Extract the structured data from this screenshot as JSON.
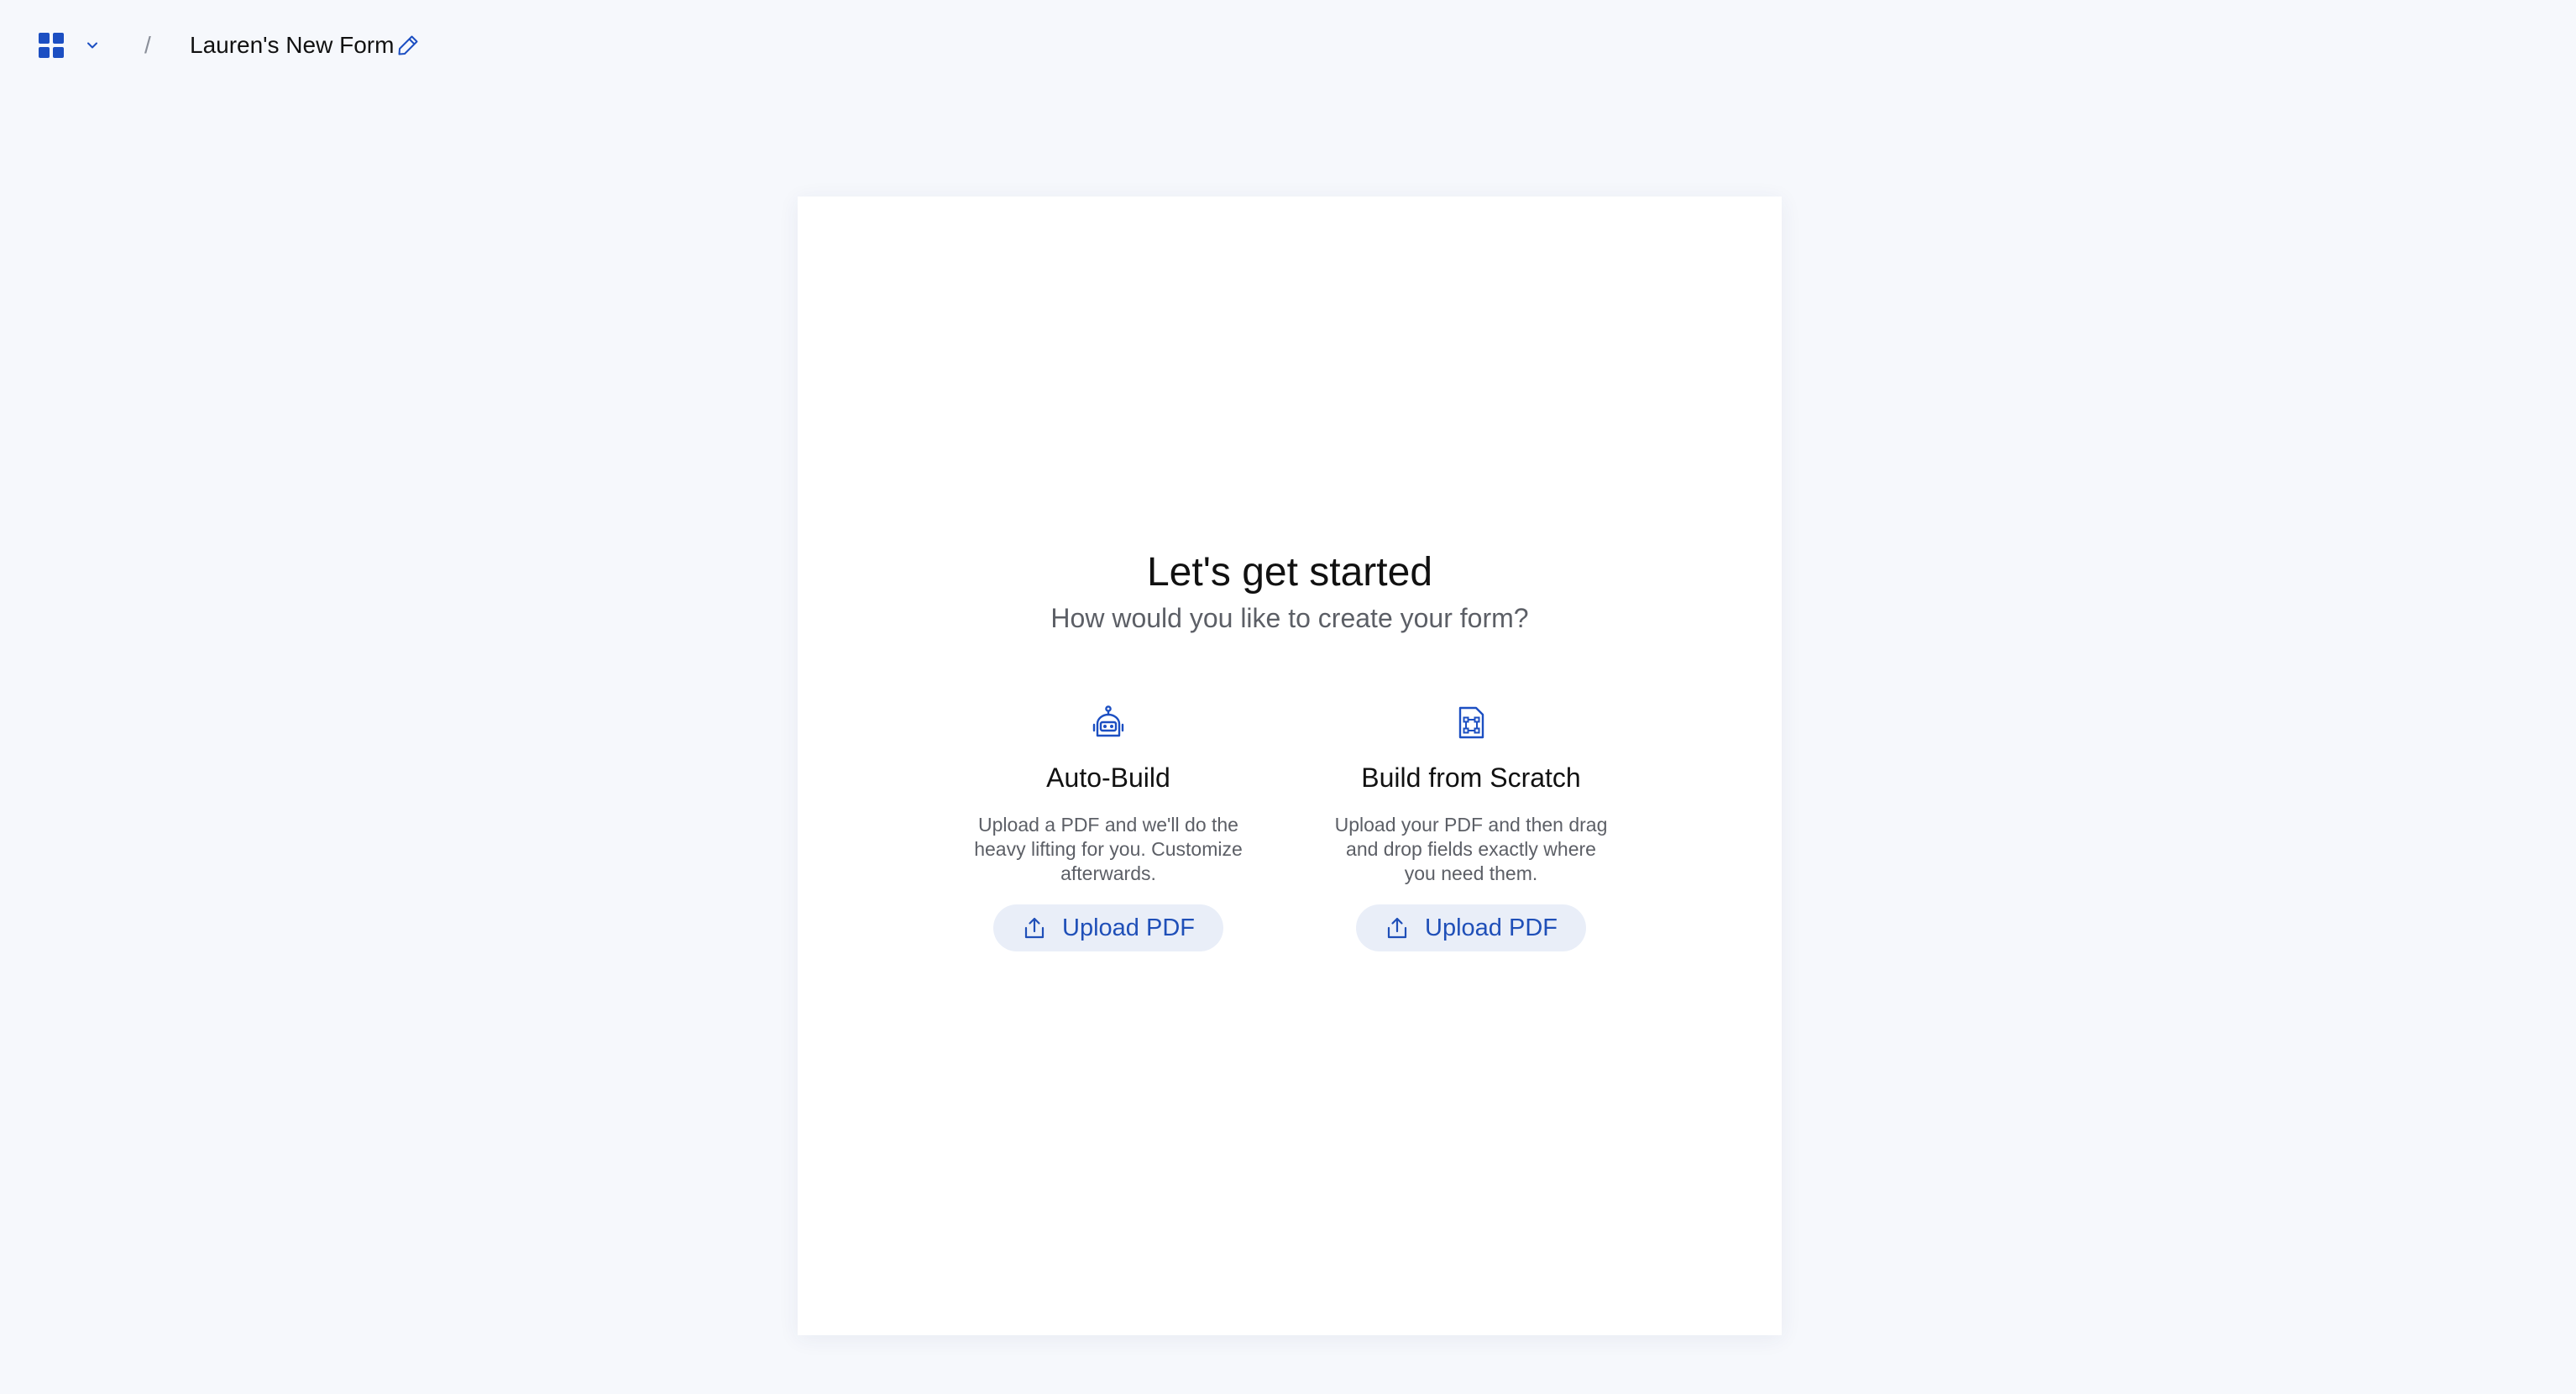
{
  "header": {
    "apps_icon": "apps-grid-icon",
    "menu_icon": "chevron-down-icon",
    "breadcrumb_separator": "/",
    "form_title": "Lauren's New Form",
    "edit_icon": "pencil-icon"
  },
  "main": {
    "heading": "Let's get started",
    "subheading": "How would you like to create your form?",
    "options": [
      {
        "icon": "robot-icon",
        "title": "Auto-Build",
        "description": "Upload a PDF and we'll do the heavy lifting for you. Customize afterwards.",
        "button_label": "Upload PDF",
        "button_icon": "upload-icon"
      },
      {
        "icon": "document-fields-icon",
        "title": "Build from Scratch",
        "description": "Upload your PDF and then drag and drop fields exactly where you need them.",
        "button_label": "Upload PDF",
        "button_icon": "upload-icon"
      }
    ]
  },
  "colors": {
    "accent": "#1c4fc2",
    "page_background": "#f6f8fc",
    "button_background": "#e9eef8",
    "card_background": "#ffffff"
  }
}
